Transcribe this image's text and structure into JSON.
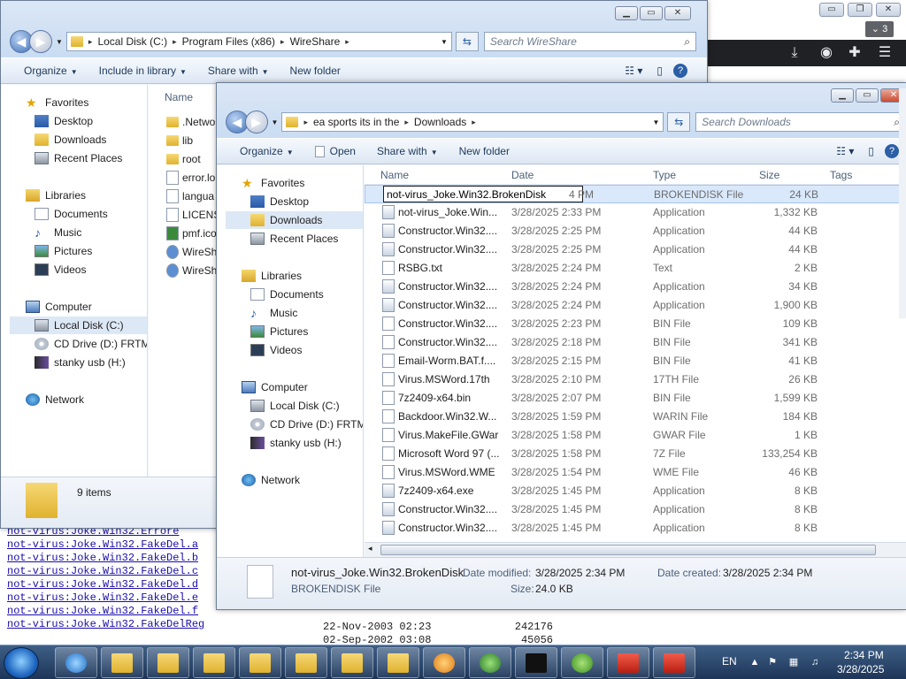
{
  "background_page": {
    "links": [
      "not-virus:Joke.Win32.Errore",
      "not-virus:Joke.Win32.FakeDel.a",
      "not-virus:Joke.Win32.FakeDel.b",
      "not-virus:Joke.Win32.FakeDel.c",
      "not-virus:Joke.Win32.FakeDel.d",
      "not-virus:Joke.Win32.FakeDel.e",
      "not-virus:Joke.Win32.FakeDel.f",
      "not-virus:Joke.Win32.FakeDelReg"
    ],
    "rows": [
      {
        "date": "22-Nov-2003 02:23",
        "size": "242176"
      },
      {
        "date": "02-Sep-2002 03:08",
        "size": "45056"
      }
    ]
  },
  "browser": {
    "tab_count": "3",
    "controls": {
      "min": "▭",
      "restore": "❐",
      "close": "✕"
    }
  },
  "win_back": {
    "breadcrumb": [
      "Local Disk (C:)",
      "Program Files (x86)",
      "WireShare"
    ],
    "search_placeholder": "Search WireShare",
    "toolbar": {
      "organize": "Organize",
      "include": "Include in library",
      "share": "Share with",
      "new_folder": "New folder"
    },
    "nav": {
      "favorites": "Favorites",
      "desktop": "Desktop",
      "downloads": "Downloads",
      "recent": "Recent Places",
      "libraries": "Libraries",
      "documents": "Documents",
      "music": "Music",
      "pictures": "Pictures",
      "videos": "Videos",
      "computer": "Computer",
      "local_disk": "Local Disk (C:)",
      "cd_drive": "CD Drive (D:) FRTME",
      "usb": "stanky usb (H:)",
      "network": "Network"
    },
    "column_name": "Name",
    "files": [
      ".Netwo",
      "lib",
      "root",
      "error.lo",
      "langua",
      "LICENS",
      "pmf.ico",
      "WireSh",
      "WireSh"
    ],
    "status": "9 items"
  },
  "win_front": {
    "breadcrumb": [
      "ea sports its in the",
      "Downloads"
    ],
    "search_placeholder": "Search Downloads",
    "toolbar": {
      "organize": "Organize",
      "open": "Open",
      "share": "Share with",
      "new_folder": "New folder"
    },
    "nav": {
      "favorites": "Favorites",
      "desktop": "Desktop",
      "downloads": "Downloads",
      "recent": "Recent Places",
      "libraries": "Libraries",
      "documents": "Documents",
      "music": "Music",
      "pictures": "Pictures",
      "videos": "Videos",
      "computer": "Computer",
      "local_disk": "Local Disk (C:)",
      "cd_drive": "CD Drive (D:) FRTME",
      "usb": "stanky usb (H:)",
      "network": "Network"
    },
    "columns": {
      "name": "Name",
      "date": "Date",
      "type": "Type",
      "size": "Size",
      "tags": "Tags"
    },
    "rename_value": "not-virus_Joke.Win32.BrokenDisk",
    "files": [
      {
        "name": "not-virus_Joke.Win32.BrokenDisk",
        "date": "4 PM",
        "type": "BROKENDISK File",
        "size": "24 KB"
      },
      {
        "name": "not-virus_Joke.Win...",
        "date": "3/28/2025 2:33 PM",
        "type": "Application",
        "size": "1,332 KB"
      },
      {
        "name": "Constructor.Win32....",
        "date": "3/28/2025 2:25 PM",
        "type": "Application",
        "size": "44 KB"
      },
      {
        "name": "Constructor.Win32....",
        "date": "3/28/2025 2:25 PM",
        "type": "Application",
        "size": "44 KB"
      },
      {
        "name": "RSBG.txt",
        "date": "3/28/2025 2:24 PM",
        "type": "Text",
        "size": "2 KB"
      },
      {
        "name": "Constructor.Win32....",
        "date": "3/28/2025 2:24 PM",
        "type": "Application",
        "size": "34 KB"
      },
      {
        "name": "Constructor.Win32....",
        "date": "3/28/2025 2:24 PM",
        "type": "Application",
        "size": "1,900 KB"
      },
      {
        "name": "Constructor.Win32....",
        "date": "3/28/2025 2:23 PM",
        "type": "BIN File",
        "size": "109 KB"
      },
      {
        "name": "Constructor.Win32....",
        "date": "3/28/2025 2:18 PM",
        "type": "BIN File",
        "size": "341 KB"
      },
      {
        "name": "Email-Worm.BAT.f....",
        "date": "3/28/2025 2:15 PM",
        "type": "BIN File",
        "size": "41 KB"
      },
      {
        "name": "Virus.MSWord.17th",
        "date": "3/28/2025 2:10 PM",
        "type": "17TH File",
        "size": "26 KB"
      },
      {
        "name": "7z2409-x64.bin",
        "date": "3/28/2025 2:07 PM",
        "type": "BIN File",
        "size": "1,599 KB"
      },
      {
        "name": "Backdoor.Win32.W...",
        "date": "3/28/2025 1:59 PM",
        "type": "WARIN File",
        "size": "184 KB"
      },
      {
        "name": "Virus.MakeFile.GWar",
        "date": "3/28/2025 1:58 PM",
        "type": "GWAR File",
        "size": "1 KB"
      },
      {
        "name": "Microsoft Word 97 (...",
        "date": "3/28/2025 1:58 PM",
        "type": "7Z File",
        "size": "133,254 KB"
      },
      {
        "name": "Virus.MSWord.WME",
        "date": "3/28/2025 1:54 PM",
        "type": "WME File",
        "size": "46 KB"
      },
      {
        "name": "7z2409-x64.exe",
        "date": "3/28/2025 1:45 PM",
        "type": "Application",
        "size": "8 KB"
      },
      {
        "name": "Constructor.Win32....",
        "date": "3/28/2025 1:45 PM",
        "type": "Application",
        "size": "8 KB"
      },
      {
        "name": "Constructor.Win32....",
        "date": "3/28/2025 1:45 PM",
        "type": "Application",
        "size": "8 KB"
      }
    ],
    "details": {
      "name": "not-virus_Joke.Win32.BrokenDisk",
      "type": "BROKENDISK File",
      "modified_label": "Date modified:",
      "modified": "3/28/2025 2:34 PM",
      "created_label": "Date created:",
      "created": "3/28/2025 2:34 PM",
      "size_label": "Size:",
      "size": "24.0 KB"
    }
  },
  "taskbar": {
    "lang": "EN",
    "time": "2:34 PM",
    "date": "3/28/2025"
  }
}
